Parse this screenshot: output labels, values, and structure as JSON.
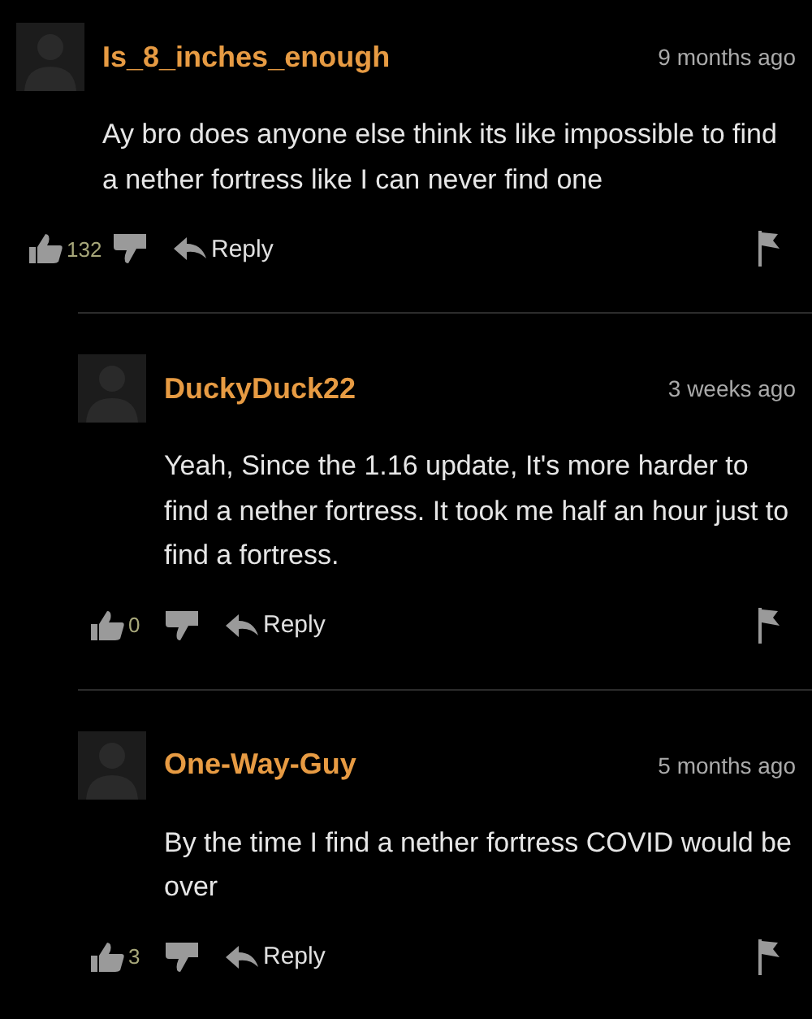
{
  "comments": [
    {
      "username": "Is_8_inches_enough",
      "time": "9 months ago",
      "text": "Ay bro does anyone else think its like impossible to find a nether fortress like I can never find one",
      "likes": "132",
      "reply_label": "Reply",
      "children": [
        {
          "username": "DuckyDuck22",
          "time": "3 weeks ago",
          "text": "Yeah, Since the 1.16 update, It's more harder to find a nether fortress. It took me half an hour just to find a fortress.",
          "likes": "0",
          "reply_label": "Reply"
        },
        {
          "username": "One-Way-Guy",
          "time": "5 months ago",
          "text": "By the time I find a nether fortress COVID would be over",
          "likes": "3",
          "reply_label": "Reply"
        }
      ]
    }
  ]
}
